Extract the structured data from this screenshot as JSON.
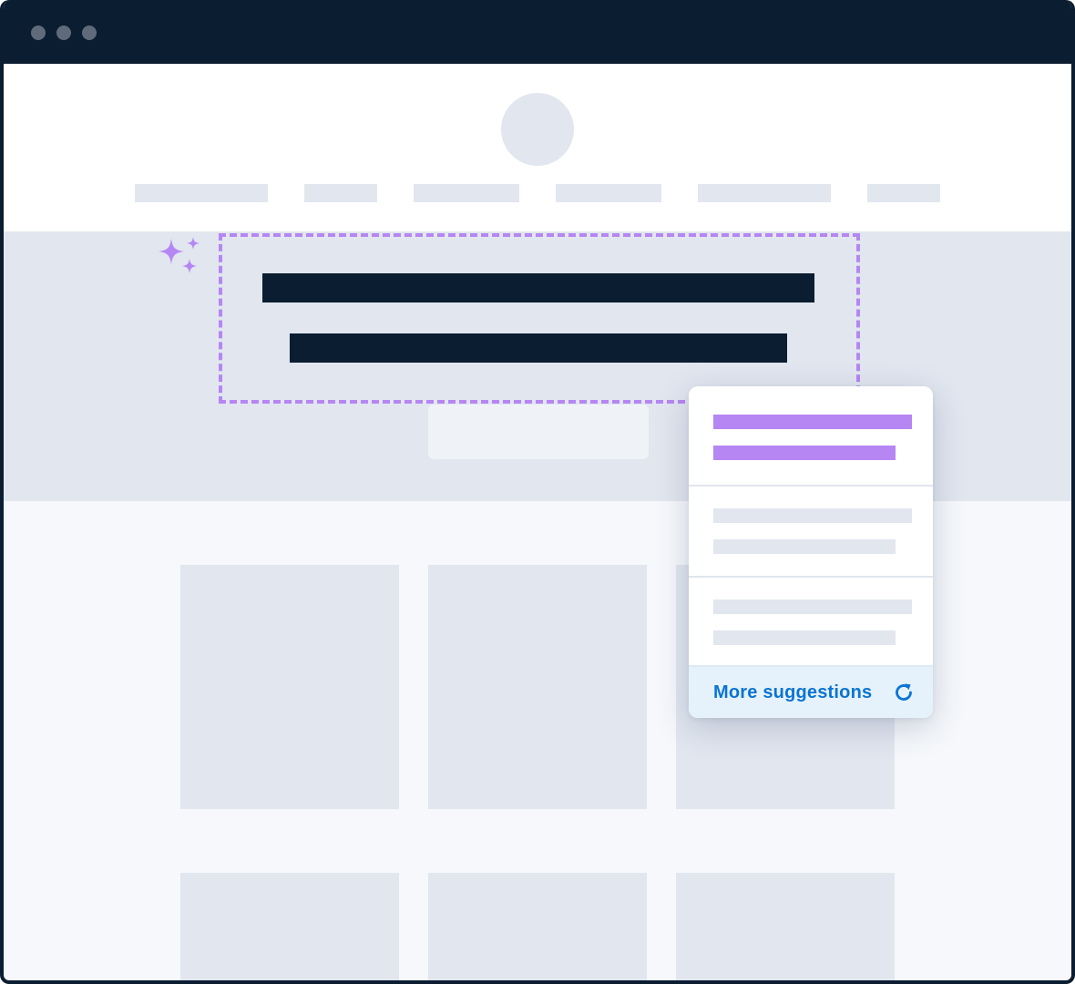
{
  "window": {
    "controls": [
      "close-dot",
      "minimize-dot",
      "maximize-dot"
    ],
    "frame_color": "#0b1d31"
  },
  "colors": {
    "accent": "#b686f3",
    "link": "#0a74d3",
    "placeholder": "#e1e6ef"
  },
  "suggestions_popover": {
    "items": [
      "suggestion-selected",
      "suggestion-2",
      "suggestion-3"
    ],
    "more_label": "More suggestions",
    "more_icon": "refresh-icon"
  },
  "hero": {
    "sparkle_icon": "sparkle-icon"
  }
}
